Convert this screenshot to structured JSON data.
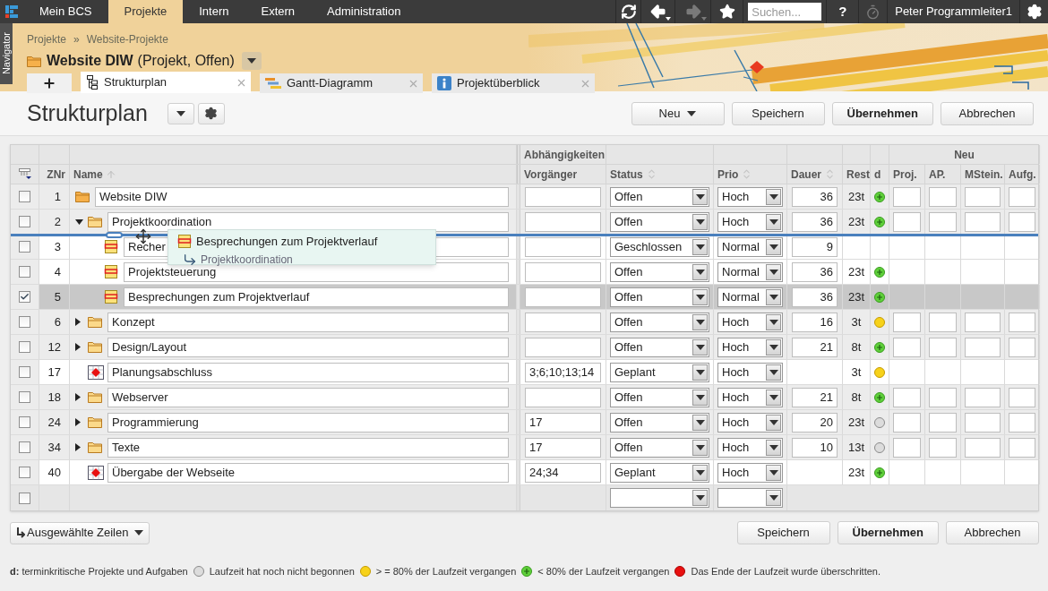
{
  "top_nav": {
    "items": [
      {
        "label": "Mein BCS",
        "selected": false
      },
      {
        "label": "Projekte",
        "selected": true
      },
      {
        "label": "Intern",
        "selected": false
      },
      {
        "label": "Extern",
        "selected": false
      },
      {
        "label": "Administration",
        "selected": false
      }
    ]
  },
  "toolbar": [
    {
      "kind": "refresh",
      "disabled": false
    },
    {
      "kind": "back",
      "disabled": false
    },
    {
      "kind": "forward",
      "disabled": true
    },
    {
      "kind": "star",
      "disabled": false
    },
    {
      "kind": "search",
      "placeholder": "Suchen..."
    },
    {
      "kind": "help",
      "label": "?"
    },
    {
      "kind": "timer",
      "disabled": true
    },
    {
      "kind": "user",
      "label": "Peter Programmleiter1"
    },
    {
      "kind": "settings"
    }
  ],
  "navigator": {
    "label": "Navigator"
  },
  "breadcrumb": {
    "items": [
      "Projekte",
      "Website-Projekte"
    ],
    "separator": "»"
  },
  "project": {
    "name": "Website DIW",
    "info": "(Projekt, Offen)"
  },
  "tabs": [
    {
      "label": "Strukturplan",
      "kind": "structure",
      "selected": true
    },
    {
      "label": "Gantt-Diagramm",
      "kind": "gantt",
      "selected": false
    },
    {
      "label": "Projektüberblick",
      "kind": "info",
      "selected": false
    }
  ],
  "page": {
    "title": "Strukturplan",
    "buttons": [
      {
        "label": "Neu",
        "kind": "menu"
      },
      {
        "label": "Speichern",
        "kind": "normal"
      },
      {
        "label": "Übernehmen",
        "kind": "primary"
      },
      {
        "label": "Abbrechen",
        "kind": "normal"
      }
    ]
  },
  "table": {
    "group_headers": {
      "dependencies": "Abhängigkeiten",
      "new": "Neu"
    },
    "columns": [
      {
        "label": "ZNr",
        "kind": "plain"
      },
      {
        "label": "Name",
        "kind": "sorted_asc"
      },
      {
        "label": "Vorgänger",
        "kind": "plain"
      },
      {
        "label": "Status",
        "kind": "sortable"
      },
      {
        "label": "Prio",
        "kind": "sortable"
      },
      {
        "label": "Dauer",
        "kind": "sortable"
      },
      {
        "label": "Rest",
        "kind": "plain"
      },
      {
        "label": "d",
        "kind": "plain"
      },
      {
        "label": "Proj.",
        "kind": "plain"
      },
      {
        "label": "AP.",
        "kind": "plain"
      },
      {
        "label": "MStein.",
        "kind": "plain"
      },
      {
        "label": "Aufg.",
        "kind": "plain"
      }
    ],
    "rows": [
      {
        "znr": "1",
        "name": "Website DIW",
        "kind": "project",
        "checked": false,
        "status": "Offen",
        "prio": "Hoch",
        "duration": "36",
        "rest": "23t",
        "deadline": {
          "kind": "under80"
        },
        "children": [
          {
            "znr": "2",
            "name": "Projektkoordination",
            "kind": "folder",
            "expanded": true,
            "checked": false,
            "status": "Offen",
            "prio": "Hoch",
            "duration": "36",
            "rest": "23t",
            "deadline": {
              "kind": "under80"
            },
            "children": [
              {
                "znr": "3",
                "name": "Recher",
                "kind": "task",
                "checked": false,
                "status": "Geschlossen",
                "prio": "Normal",
                "duration": "9"
              },
              {
                "znr": "4",
                "name": "Projektsteuerung",
                "kind": "task",
                "checked": false,
                "status": "Offen",
                "prio": "Normal",
                "duration": "36",
                "rest": "23t",
                "deadline": {
                  "kind": "under80"
                }
              },
              {
                "znr": "5",
                "name": "Besprechungen zum Projektverlauf",
                "kind": "task",
                "checked": true,
                "status": "Offen",
                "prio": "Normal",
                "duration": "36",
                "rest": "23t",
                "deadline": {
                  "kind": "under80"
                }
              }
            ]
          },
          {
            "znr": "6",
            "name": "Konzept",
            "kind": "folder",
            "expanded": false,
            "checked": false,
            "status": "Offen",
            "prio": "Hoch",
            "duration": "16",
            "rest": "3t",
            "deadline": {
              "kind": "over80"
            }
          },
          {
            "znr": "12",
            "name": "Design/Layout",
            "kind": "folder",
            "expanded": false,
            "checked": false,
            "status": "Offen",
            "prio": "Hoch",
            "duration": "21",
            "rest": "8t",
            "deadline": {
              "kind": "under80"
            }
          },
          {
            "znr": "17",
            "name": "Planungsabschluss",
            "kind": "milestone",
            "checked": false,
            "predecessors": "3;6;10;13;14",
            "status": "Geplant",
            "prio": "Hoch",
            "rest": "3t",
            "deadline": {
              "kind": "over80"
            }
          },
          {
            "znr": "18",
            "name": "Webserver",
            "kind": "folder",
            "expanded": false,
            "checked": false,
            "status": "Offen",
            "prio": "Hoch",
            "duration": "21",
            "rest": "8t",
            "deadline": {
              "kind": "under80"
            }
          },
          {
            "znr": "24",
            "name": "Programmierung",
            "kind": "folder",
            "expanded": false,
            "checked": false,
            "predecessors": "17",
            "status": "Offen",
            "prio": "Hoch",
            "duration": "20",
            "rest": "23t",
            "deadline": {
              "kind": "not_started"
            }
          },
          {
            "znr": "34",
            "name": "Texte",
            "kind": "folder",
            "expanded": false,
            "checked": false,
            "predecessors": "17",
            "status": "Offen",
            "prio": "Hoch",
            "duration": "10",
            "rest": "13t",
            "deadline": {
              "kind": "not_started"
            }
          },
          {
            "znr": "40",
            "name": "Übergabe der Webseite",
            "kind": "milestone",
            "checked": false,
            "predecessors": "24;34",
            "status": "Geplant",
            "prio": "Hoch",
            "rest": "23t",
            "deadline": {
              "kind": "under80"
            }
          }
        ]
      }
    ],
    "new_row": {
      "checked": false
    }
  },
  "drag": {
    "label": "Besprechungen zum Projektverlauf",
    "target": "Projektkoordination"
  },
  "bottom": {
    "selection_button": "Ausgewählte Zeilen",
    "buttons": [
      {
        "label": "Speichern",
        "kind": "normal"
      },
      {
        "label": "Übernehmen",
        "kind": "primary"
      },
      {
        "label": "Abbrechen",
        "kind": "normal"
      }
    ]
  },
  "legend": {
    "intro": "**d:** terminkritische Projekte und Aufgaben",
    "items": [
      {
        "kind": "not_started",
        "label": "Laufzeit hat noch nicht begonnen"
      },
      {
        "kind": "over80",
        "label": "> = 80% der Laufzeit vergangen"
      },
      {
        "kind": "under80",
        "label": "< 80% der Laufzeit vergangen"
      },
      {
        "kind": "overdue",
        "label": "Das Ende der Laufzeit wurde überschritten."
      }
    ]
  }
}
